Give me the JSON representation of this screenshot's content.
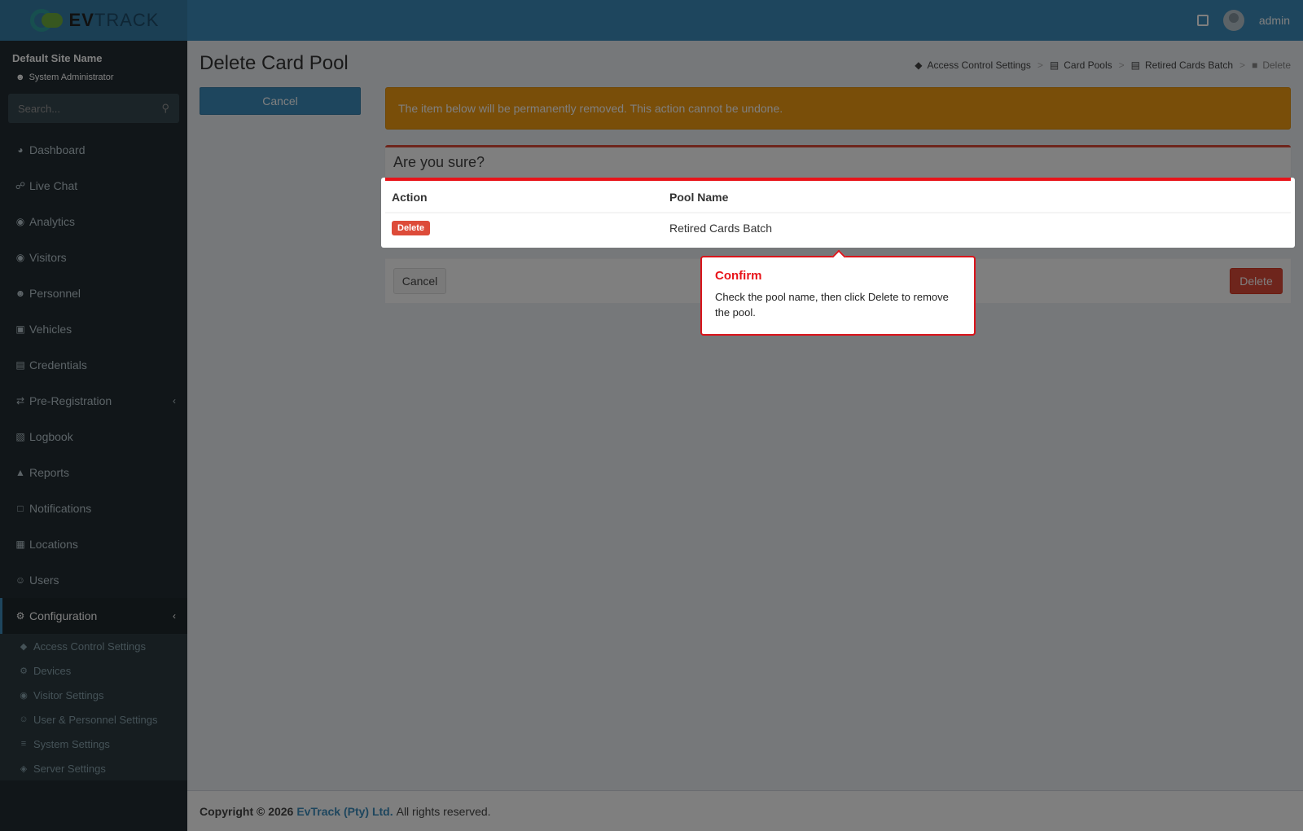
{
  "header": {
    "logo_text_bold": "EV",
    "logo_text_rest": "TRACK",
    "user": "admin"
  },
  "sidebar": {
    "site_name": "Default Site Name",
    "role": "System Administrator",
    "search_placeholder": "Search...",
    "items": [
      {
        "label": "Dashboard",
        "icon": "dashboard-icon"
      },
      {
        "label": "Live Chat",
        "icon": "headset-icon"
      },
      {
        "label": "Analytics",
        "icon": "target-icon"
      },
      {
        "label": "Visitors",
        "icon": "eye-icon"
      },
      {
        "label": "Personnel",
        "icon": "user-tie-icon"
      },
      {
        "label": "Vehicles",
        "icon": "car-icon"
      },
      {
        "label": "Credentials",
        "icon": "id-card-icon"
      },
      {
        "label": "Pre-Registration",
        "icon": "exchange-icon"
      },
      {
        "label": "Logbook",
        "icon": "book-icon"
      },
      {
        "label": "Reports",
        "icon": "chart-icon"
      },
      {
        "label": "Notifications",
        "icon": "chat-icon"
      },
      {
        "label": "Locations",
        "icon": "map-icon"
      },
      {
        "label": "Users",
        "icon": "users-icon"
      },
      {
        "label": "Configuration",
        "icon": "gear-icon"
      }
    ],
    "submenu": [
      {
        "label": "Access Control Settings",
        "icon": "lock-icon"
      },
      {
        "label": "Devices",
        "icon": "cog-icon"
      },
      {
        "label": "Visitor Settings",
        "icon": "eye-icon"
      },
      {
        "label": "User & Personnel Settings",
        "icon": "user-cog-icon"
      },
      {
        "label": "System Settings",
        "icon": "sliders-icon"
      },
      {
        "label": "Server Settings",
        "icon": "server-icon"
      }
    ]
  },
  "page": {
    "title": "Delete Card Pool",
    "cancel_label": "Cancel",
    "breadcrumb": [
      "Access Control Settings",
      "Card Pools",
      "Retired Cards Batch",
      "Delete"
    ],
    "warning": "The item below will be permanently removed. This action cannot be undone.",
    "box_title": "Are you sure?",
    "table": {
      "headers": [
        "Action",
        "Pool Name"
      ],
      "rows": [
        {
          "action": "Delete",
          "pool_name": "Retired Cards Batch"
        }
      ]
    },
    "footer_cancel": "Cancel",
    "footer_delete": "Delete"
  },
  "tooltip": {
    "title": "Confirm",
    "body": "Check the pool name, then click Delete to remove the pool."
  },
  "footer": {
    "copyright": "Copyright © 2026",
    "company": "EvTrack (Pty) Ltd.",
    "rights": "All rights reserved."
  },
  "colors": {
    "header": "#3c8dbc",
    "sidebar": "#222d32",
    "warning": "#f39c12",
    "danger": "#dd4b39",
    "highlight": "#e8141a"
  }
}
